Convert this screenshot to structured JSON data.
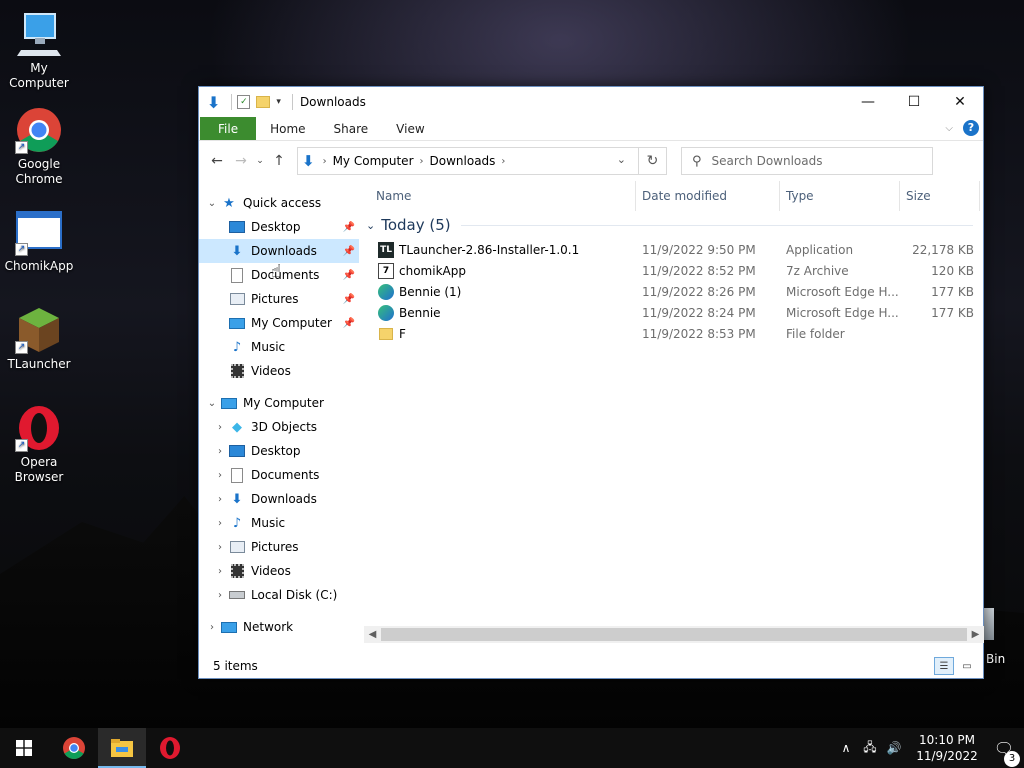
{
  "desktop": {
    "icons": [
      {
        "label": "My Computer"
      },
      {
        "label": "Google Chrome"
      },
      {
        "label": "ChomikApp"
      },
      {
        "label": "TLauncher"
      },
      {
        "label": "Opera Browser"
      }
    ],
    "recycle_label": "Bin"
  },
  "window": {
    "title": "Downloads",
    "controls": {
      "minimize": "—",
      "maximize": "☐",
      "close": "✕"
    },
    "ribbon_tabs": [
      "File",
      "Home",
      "Share",
      "View"
    ],
    "help": "?",
    "address": {
      "crumbs": [
        "My Computer",
        "Downloads"
      ]
    },
    "search": {
      "placeholder": "Search Downloads"
    },
    "tree": {
      "quick_access": {
        "label": "Quick access",
        "items": [
          "Desktop",
          "Downloads",
          "Documents",
          "Pictures",
          "My Computer",
          "Music",
          "Videos"
        ]
      },
      "my_computer": {
        "label": "My Computer",
        "items": [
          "3D Objects",
          "Desktop",
          "Documents",
          "Downloads",
          "Music",
          "Pictures",
          "Videos",
          "Local Disk (C:)"
        ]
      },
      "network": {
        "label": "Network"
      }
    },
    "columns": {
      "name": "Name",
      "date": "Date modified",
      "type": "Type",
      "size": "Size"
    },
    "group": {
      "label": "Today (5)"
    },
    "files": [
      {
        "name": "TLauncher-2.86-Installer-1.0.1",
        "date": "11/9/2022 9:50 PM",
        "type": "Application",
        "size": "22,178 KB",
        "icon": "tlauncher-icon"
      },
      {
        "name": "chomikApp",
        "date": "11/9/2022 8:52 PM",
        "type": "7z Archive",
        "size": "120 KB",
        "icon": "archive-icon"
      },
      {
        "name": "Bennie (1)",
        "date": "11/9/2022 8:26 PM",
        "type": "Microsoft Edge H...",
        "size": "177 KB",
        "icon": "edge-icon"
      },
      {
        "name": "Bennie",
        "date": "11/9/2022 8:24 PM",
        "type": "Microsoft Edge H...",
        "size": "177 KB",
        "icon": "edge-icon"
      },
      {
        "name": "F",
        "date": "11/9/2022 8:53 PM",
        "type": "File folder",
        "size": "",
        "icon": "folder-icon"
      }
    ],
    "status": {
      "items": "5 items"
    }
  },
  "taskbar": {
    "time": "10:10 PM",
    "date": "11/9/2022",
    "notifications": "3"
  }
}
